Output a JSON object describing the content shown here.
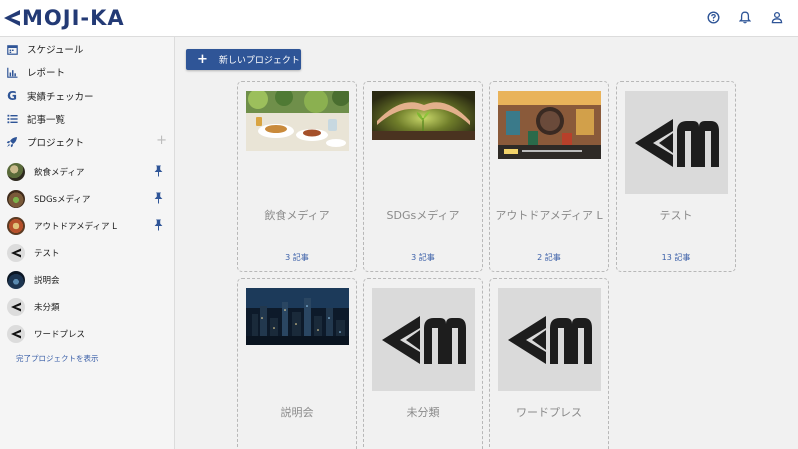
{
  "header": {
    "logo_text": "MOJI-KA",
    "brand_color": "#233a75",
    "icons": [
      "help-icon",
      "bell-icon",
      "user-icon"
    ]
  },
  "sidebar": {
    "nav": [
      {
        "label": "スケジュール",
        "icon": "calendar-icon"
      },
      {
        "label": "レポート",
        "icon": "bar-chart-icon"
      },
      {
        "label": "実績チェッカー",
        "icon": "google-icon"
      },
      {
        "label": "記事一覧",
        "icon": "list-icon"
      },
      {
        "label": "プロジェクト",
        "icon": "rocket-icon",
        "add": "+"
      }
    ],
    "projects": [
      {
        "label": "飲食メディア",
        "pinned": true
      },
      {
        "label": "SDGsメディア",
        "pinned": true
      },
      {
        "label": "アウトドアメディア L",
        "pinned": true
      },
      {
        "label": "テスト",
        "pinned": false
      },
      {
        "label": "説明会",
        "pinned": false
      },
      {
        "label": "未分類",
        "pinned": false
      },
      {
        "label": "ワードプレス",
        "pinned": false
      }
    ],
    "show_completed": "完了プロジェクトを表示"
  },
  "main": {
    "new_project_label": "新しいプロジェクト",
    "new_project_icon": "+",
    "cards": [
      {
        "title": "飲食メディア",
        "count": "3 記事",
        "thumb": "food"
      },
      {
        "title": "SDGsメディア",
        "count": "3 記事",
        "thumb": "sprout"
      },
      {
        "title": "アウトドアメディア L",
        "count": "2 記事",
        "thumb": "outdoor"
      },
      {
        "title": "テスト",
        "count": "13 記事",
        "thumb": "logo"
      },
      {
        "title": "説明会",
        "count": "",
        "thumb": "city"
      },
      {
        "title": "未分類",
        "count": "",
        "thumb": "logo"
      },
      {
        "title": "ワードプレス",
        "count": "",
        "thumb": "logo"
      }
    ]
  },
  "colors": {
    "accent": "#2f5597",
    "link": "#3a5fa8"
  }
}
